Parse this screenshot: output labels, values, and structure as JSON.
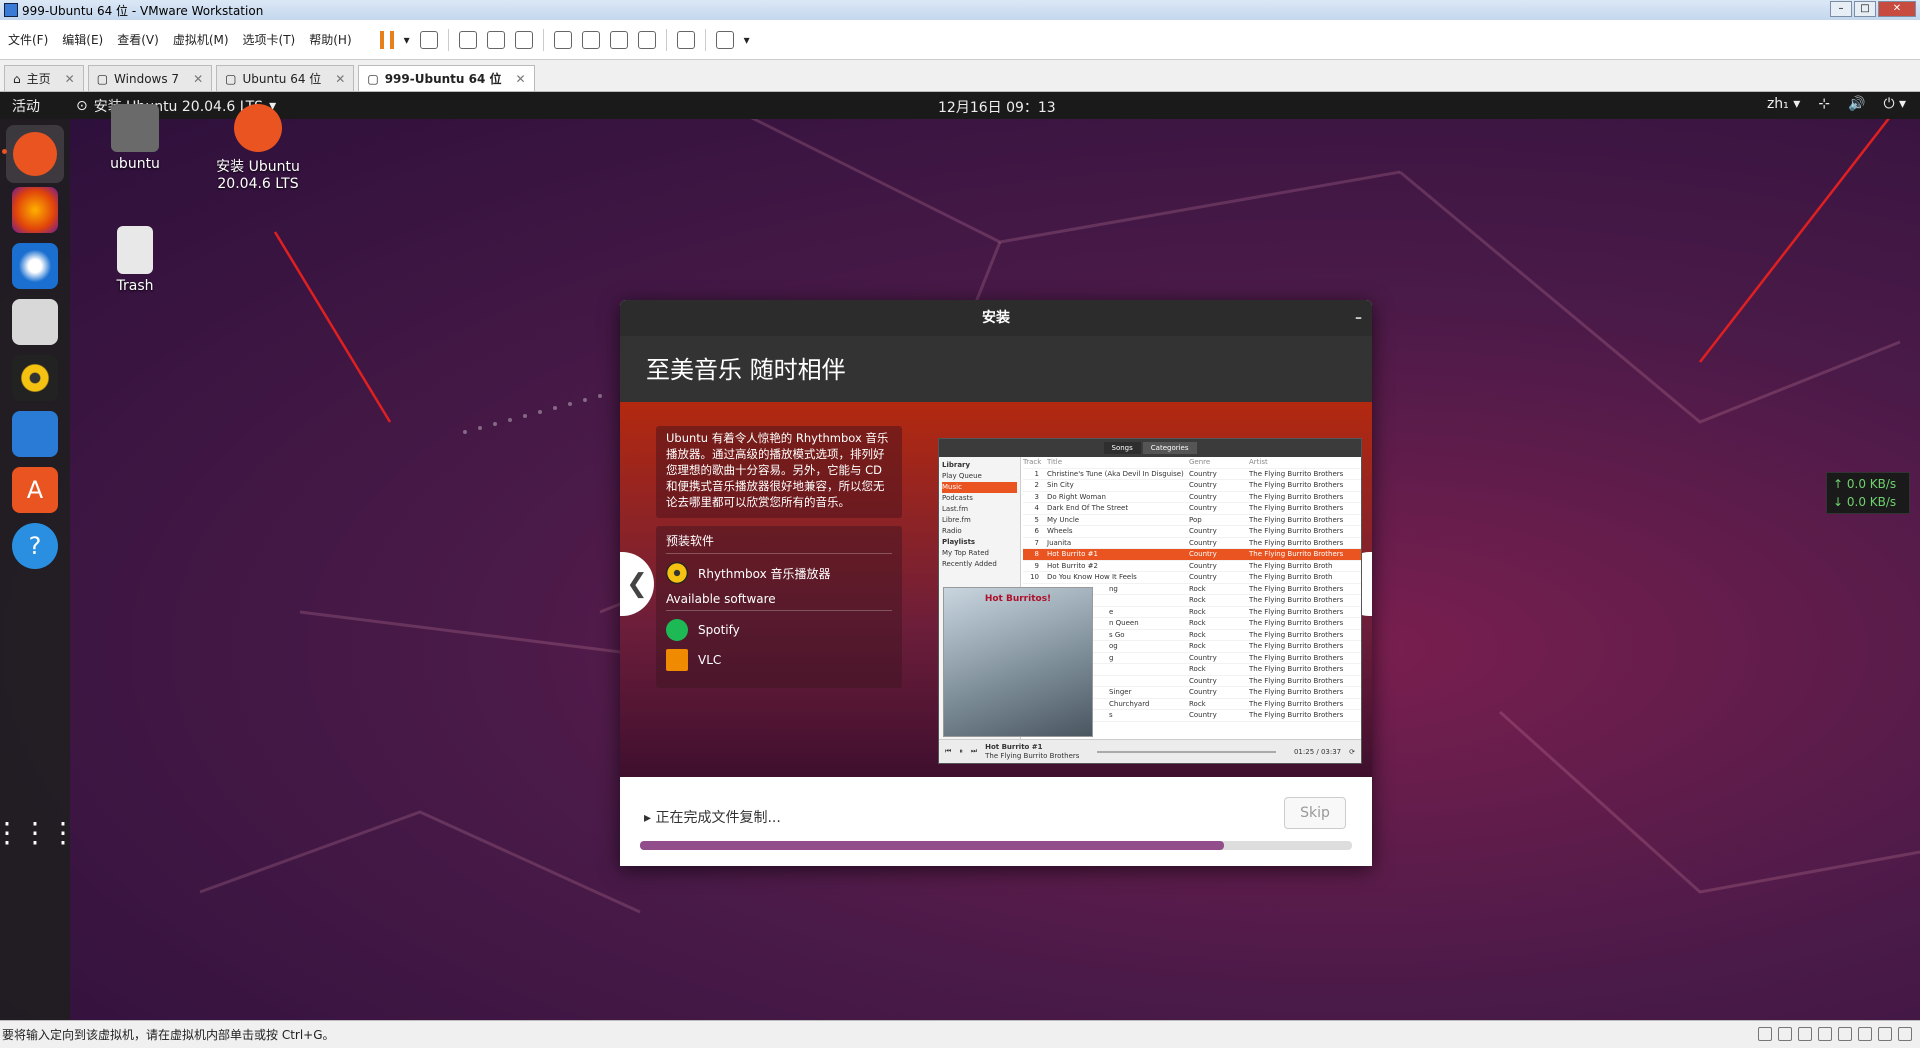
{
  "window": {
    "title": "999-Ubuntu 64 位 - VMware Workstation"
  },
  "menu": [
    "文件(F)",
    "编辑(E)",
    "查看(V)",
    "虚拟机(M)",
    "选项卡(T)",
    "帮助(H)"
  ],
  "tabs": [
    {
      "label": "主页"
    },
    {
      "label": "Windows 7"
    },
    {
      "label": "Ubuntu 64 位"
    },
    {
      "label": "999-Ubuntu 64 位"
    }
  ],
  "ubuntu": {
    "activities": "活动",
    "app_menu": "安装 Ubuntu 20.04.6 LTS",
    "clock": "12月16日  09：13",
    "lang": "zh₁"
  },
  "desktop": {
    "home": "ubuntu",
    "installer": "安装 Ubuntu 20.04.6 LTS",
    "trash": "Trash"
  },
  "netmon": {
    "up": "↑ 0.0 KB/s",
    "down": "↓ 0.0 KB/s"
  },
  "dialog": {
    "title": "安装",
    "heading": "至美音乐 随时相伴",
    "description": "Ubuntu 有着令人惊艳的 Rhythmbox 音乐播放器。通过高级的播放模式选项，排列好您理想的歌曲十分容易。另外，它能与 CD 和便携式音乐播放器很好地兼容，所以您无论去哪里都可以欣赏您所有的音乐。",
    "preinstalled_heading": "预装软件",
    "preinstalled": "Rhythmbox 音乐播放器",
    "available_heading": "Available software",
    "available": [
      "Spotify",
      "VLC"
    ],
    "progress_label": "正在完成文件复制...",
    "skip": "Skip",
    "progress": 0.82
  },
  "rhythmbox": {
    "tabs": [
      "Songs",
      "Categories"
    ],
    "library": [
      "Library",
      "Play Queue",
      "Music",
      "Podcasts",
      "Last.fm",
      "Libre.fm",
      "Radio",
      "Playlists",
      "My Top Rated",
      "Recently Added"
    ],
    "header": [
      "",
      "Track",
      "Title",
      "Genre",
      "Artist"
    ],
    "rows": [
      [
        "1",
        "Christine's Tune (Aka Devil In Disguise)",
        "Country",
        "The Flying Burrito Brothers"
      ],
      [
        "2",
        "Sin City",
        "Country",
        "The Flying Burrito Brothers"
      ],
      [
        "3",
        "Do Right Woman",
        "Country",
        "The Flying Burrito Brothers"
      ],
      [
        "4",
        "Dark End Of The Street",
        "Country",
        "The Flying Burrito Brothers"
      ],
      [
        "5",
        "My Uncle",
        "Pop",
        "The Flying Burrito Brothers"
      ],
      [
        "6",
        "Wheels",
        "Country",
        "The Flying Burrito Brothers"
      ],
      [
        "7",
        "Juanita",
        "Country",
        "The Flying Burrito Brothers"
      ],
      [
        "8",
        "Hot Burrito #1",
        "Country",
        "The Flying Burrito Brothers"
      ],
      [
        "9",
        "Hot Burrito #2",
        "Country",
        "The Flying Burrito Broth"
      ],
      [
        "10",
        "Do You Know How It Feels",
        "Country",
        "The Flying Burrito Broth"
      ],
      [
        "",
        "ng",
        "Rock",
        "The Flying Burrito Brothers"
      ],
      [
        "",
        "",
        "Rock",
        "The Flying Burrito Brothers"
      ],
      [
        "",
        "e",
        "Rock",
        "The Flying Burrito Brothers"
      ],
      [
        "",
        "n Queen",
        "Rock",
        "The Flying Burrito Brothers"
      ],
      [
        "",
        "s Go",
        "Rock",
        "The Flying Burrito Brothers"
      ],
      [
        "",
        "og",
        "Rock",
        "The Flying Burrito Brothers"
      ],
      [
        "",
        "g",
        "Country",
        "The Flying Burrito Brothers"
      ],
      [
        "",
        "",
        "Rock",
        "The Flying Burrito Brothers"
      ],
      [
        "",
        "",
        "Country",
        "The Flying Burrito Brothers"
      ],
      [
        "",
        "Singer",
        "Country",
        "The Flying Burrito Brothers"
      ],
      [
        "",
        "Churchyard",
        "Rock",
        "The Flying Burrito Brothers"
      ],
      [
        "",
        "s",
        "Country",
        "The Flying Burrito Brothers"
      ]
    ],
    "now_playing": "Hot Burrito #1",
    "now_artist": "The Flying Burrito Brothers",
    "time": "01:25 / 03:37",
    "album_title": "Hot Burritos!"
  },
  "status": {
    "text": "要将输入定向到该虚拟机，请在虚拟机内部单击或按 Ctrl+G。"
  }
}
